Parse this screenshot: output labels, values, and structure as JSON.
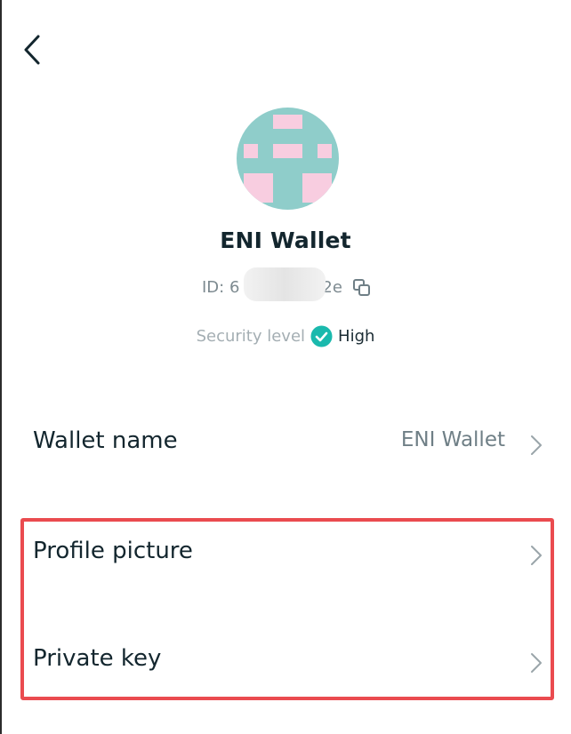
{
  "header": {
    "back_icon": "chevron-left-icon"
  },
  "profile": {
    "wallet_title": "ENI Wallet",
    "id_label": "ID: 6",
    "id_suffix": "2e",
    "copy_icon": "copy-icon",
    "security_label": "Security level",
    "security_value": "High",
    "security_icon": "check-circle-icon",
    "security_color": "#1ab9ad",
    "avatar_colors": {
      "background": "#8fcdca",
      "blocks": "#f8cde0"
    }
  },
  "settings": {
    "items": [
      {
        "label": "Wallet name",
        "value": "ENI Wallet",
        "icon": "chevron-right-icon"
      },
      {
        "label": "Profile picture",
        "value": "",
        "icon": "chevron-right-icon"
      },
      {
        "label": "Private key",
        "value": "",
        "icon": "chevron-right-icon"
      }
    ]
  },
  "highlight": {
    "color": "#ea4b4f"
  }
}
